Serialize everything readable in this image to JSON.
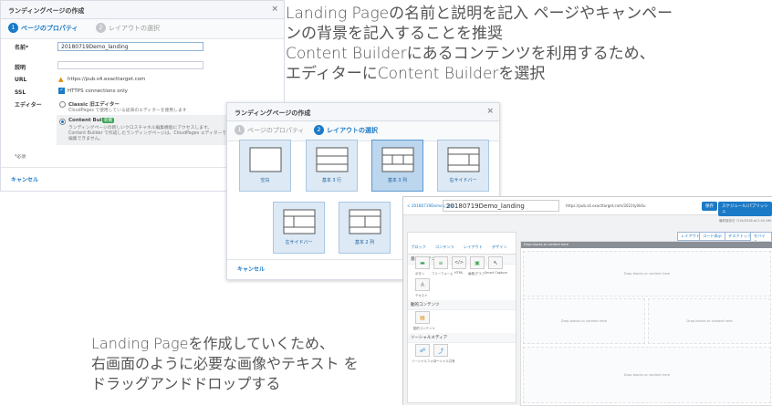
{
  "dialog1": {
    "title": "ランディングページの作成",
    "close": "×",
    "step1": {
      "num": "1",
      "label": "ページのプロパティ"
    },
    "step2": {
      "num": "2",
      "label": "レイアウトの選択"
    },
    "fields": {
      "name_label": "名前*",
      "name_value": "20180719Demo_landing",
      "desc_label": "説明",
      "url_label": "URL",
      "url_value": "https://pub.s4.exacttarget.com",
      "ssl_label": "SSL",
      "ssl_value": "HTTPS connections only",
      "editor_label": "エディター",
      "classic_title": "Classic 旧エディター",
      "classic_desc": "CloudPages で使用している従来のエディターを使用します",
      "cb_title": "Content Builder",
      "cb_badge": "新機",
      "cb_desc1": "ランディングページの新しいクロスチャネル編集機能にアクセスします。",
      "cb_desc2": "Content Builder で作成したランディングページは、CloudPages エディターでは",
      "cb_desc3": "編集できません。"
    },
    "required_note": "*必須",
    "cancel": "キャンセル"
  },
  "dialog2": {
    "title": "ランディングページの作成",
    "close": "×",
    "step1": {
      "num": "1",
      "label": "ページのプロパティ"
    },
    "step2": {
      "num": "2",
      "label": "レイアウトの選択"
    },
    "layouts": [
      "空白",
      "基本 3 行",
      "基本 3 列",
      "右サイドバー",
      "左サイドバー",
      "基本 2 列"
    ],
    "selected_layout": "基本 3 列",
    "cancel": "キャンセル"
  },
  "editor": {
    "back": "< 20180719Demo に戻る",
    "title": "20180719Demo_landing",
    "url": "https://pub.s4.exacttarget.com/3021ty0k0u",
    "save": "保存",
    "schedule": "スケジュール/パブリッシュ",
    "last_saved": "最終保存日 7/19/2018 at 2:10 AM",
    "layout_btn": "レイアウト",
    "code_btn": "コード表示",
    "desktop_btn": "デスクトップ",
    "mobile_btn": "モバイル",
    "tabs": [
      "ブロック",
      "コンテンツ",
      "レイアウト",
      "デザイン"
    ],
    "sections": {
      "basic": "基本コンテンツ",
      "dynamic": "動的コンテンツ",
      "social": "ソーシャルメディア"
    },
    "blocks": [
      "ボタン",
      "フリーフォーム",
      "HTML",
      "画像/グラフ",
      "Smart Capture",
      "テキスト"
    ],
    "dynamic_blocks": [
      "動的コンテンツ"
    ],
    "social_blocks": [
      "ソーシャルフォロー",
      "ソーシャル共有"
    ],
    "drop_text": "Drop blocks or content here"
  },
  "captions": {
    "top_line1": "Landing Pageの名前と説明を記入 ページやキャンペー",
    "top_line2": "ンの背景を記入することを推奨",
    "top_line3": "Content Builderにあるコンテンツを利用するため、",
    "top_line4": "エディターにContent Builderを選択",
    "bottom_line1": "Landing Pageを作成していくため、",
    "bottom_line2": "右画面のように必要な画像やテキスト を",
    "bottom_line3": "ドラッグアンドドロップする"
  },
  "colors": {
    "accent": "#1b7ac6",
    "tile_bg": "#dde9f5",
    "badge": "#3aa655"
  }
}
